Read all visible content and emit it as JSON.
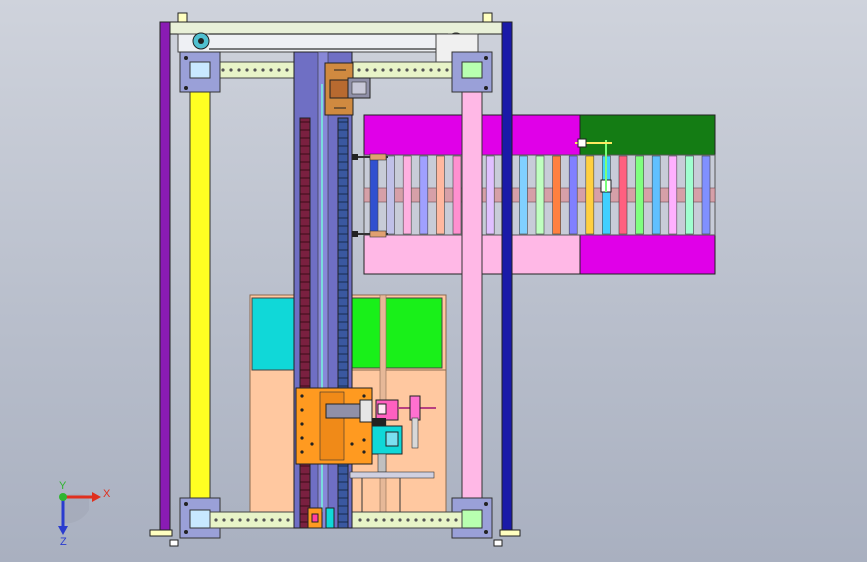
{
  "viewport": {
    "name": "cad-3d-viewport",
    "background_top": "#cfd3dc",
    "background_bottom": "#a9b0c0"
  },
  "triad": {
    "x_label": "X",
    "y_label": "Y",
    "z_label": "Z",
    "x_color": "#e0301e",
    "y_color": "#2fb52f",
    "z_color": "#2a3ccf"
  },
  "palette": {
    "frame_purple": "#8a1bb4",
    "frame_blue": "#1a1aa8",
    "beam_yellow": "#ffff22",
    "beam_pink": "#ffb8e6",
    "column": "#6f6fc4",
    "magenta": "#e000e8",
    "green_dark": "#147c14",
    "cyan": "#10d8d8",
    "green_bright": "#19f019",
    "peach": "#ffc8a0",
    "orange": "#ff9a20"
  }
}
